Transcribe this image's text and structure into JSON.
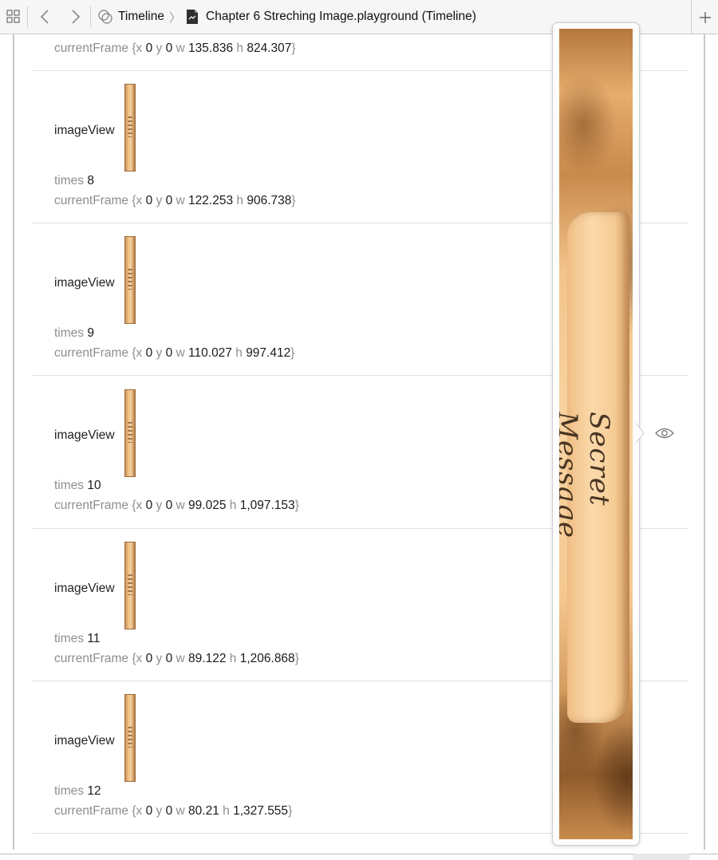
{
  "toolbar": {
    "icons": [
      "grid-icon",
      "chevron-left-icon",
      "chevron-right-icon",
      "timeline-icon",
      "playground-file-icon",
      "plus-icon"
    ],
    "breadcrumb": {
      "root": "Timeline",
      "separator": "〉",
      "file": "Chapter 6 Streching Image.playground (Timeline)"
    }
  },
  "timeline": {
    "labels": {
      "image_view": "imageView",
      "times": "times",
      "current_frame": "currentFrame",
      "x": "x",
      "y": "y",
      "w": "w",
      "h": "h",
      "open_brace": "{",
      "close_brace": "}"
    },
    "top_frame": {
      "x": "0",
      "y": "0",
      "w": "135.836",
      "h": "824.307"
    },
    "entries": [
      {
        "times": "8",
        "x": "0",
        "y": "0",
        "w": "122.253",
        "h": "906.738"
      },
      {
        "times": "9",
        "x": "0",
        "y": "0",
        "w": "110.027",
        "h": "997.412"
      },
      {
        "times": "10",
        "x": "0",
        "y": "0",
        "w": "99.025",
        "h": "1,097.153"
      },
      {
        "times": "11",
        "x": "0",
        "y": "0",
        "w": "89.122",
        "h": "1,206.868"
      },
      {
        "times": "12",
        "x": "0",
        "y": "0",
        "w": "80.21",
        "h": "1,327.555"
      }
    ]
  },
  "popover": {
    "image_text": "Secret Message",
    "icon": "eye-icon"
  },
  "colors": {
    "label_gray": "#8e8e8e",
    "value_dark": "#1b1b1b",
    "divider": "#e2e2e2",
    "image_tan": "#f3c48c",
    "image_brown": "#8f5a2b"
  }
}
